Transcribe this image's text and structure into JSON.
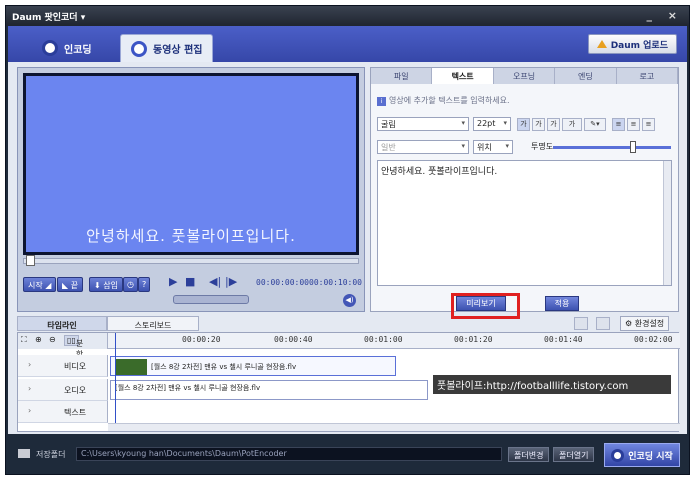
{
  "window": {
    "title": "Daum 팟인코더 ▾",
    "controls": "_ ×"
  },
  "main_tabs": [
    {
      "label": "인코딩"
    },
    {
      "label": "동영상 편집"
    }
  ],
  "upgrade_label": "Daum 업로드",
  "player": {
    "caption": "안녕하세요. 풋볼라이프입니다.",
    "start_btn": "시작",
    "end_btn": "끝",
    "insert_btn": "삽입",
    "time_current": "00:00:00:00",
    "time_total": "00:00:10:00"
  },
  "editor": {
    "tabs": [
      "파일",
      "텍스트",
      "오프닝",
      "엔딩",
      "로고"
    ],
    "active_tab": "텍스트",
    "hint": "영상에 추가할 텍스트를 입력하세요.",
    "font": "굴림",
    "font_size": "22pt",
    "style_select": "일반",
    "position_label": "위치",
    "opacity_label": "투명도",
    "opacity_value": 0.7,
    "text_value": "안녕하세요. 풋볼라이프입니다.",
    "preview_btn": "미리보기",
    "apply_btn": "적용",
    "format_buttons": [
      "가",
      "가",
      "가",
      "가"
    ]
  },
  "timeline": {
    "tabs": [
      "타임라인",
      "스토리보드"
    ],
    "settings_btn": "환경설정",
    "split_label": "분할",
    "ruler": [
      "00:00:20",
      "00:00:40",
      "00:01:00",
      "00:01:20",
      "00:01:40",
      "00:02:00"
    ],
    "tracks": [
      {
        "name": "비디오",
        "clip": "[월스 8강 2차전] 맨유 vs 첼시 루니골 현장음.flv"
      },
      {
        "name": "오디오",
        "clip": "[월스 8강 2차전] 맨유 vs 첼시 루니골 현장음.flv"
      },
      {
        "name": "텍스트",
        "clip": ""
      }
    ]
  },
  "watermark": "풋볼라이프:http://footballlife.tistory.com",
  "bottom": {
    "save_label": "저장폴더",
    "path": "C:\\Users\\kyoung han\\Documents\\Daum\\PotEncoder",
    "change_btn": "폴더변경",
    "open_btn": "폴더열기",
    "encode_btn": "인코딩 시작"
  }
}
